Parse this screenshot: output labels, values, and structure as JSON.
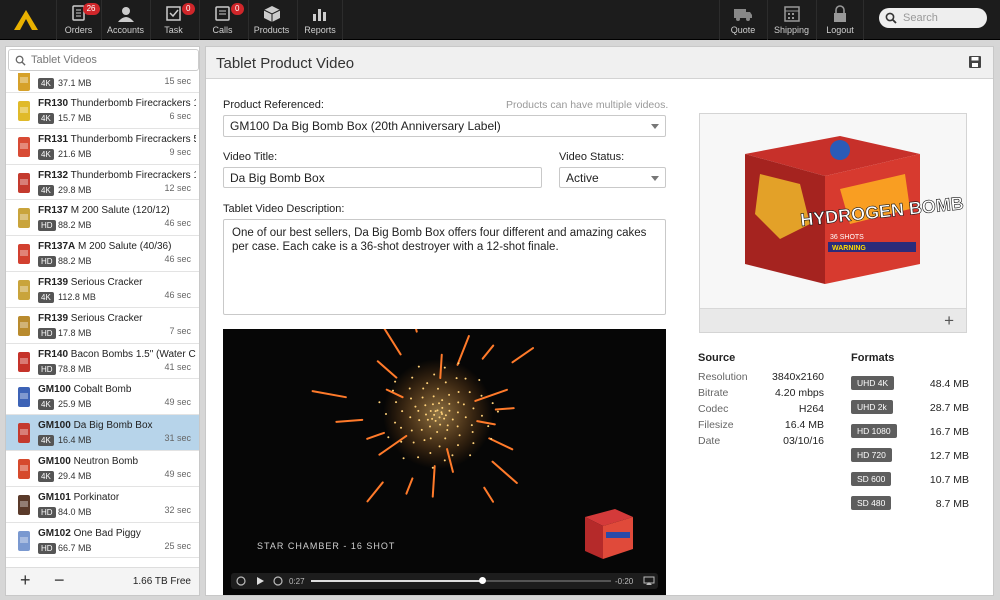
{
  "nav": {
    "items": [
      {
        "label": "Orders",
        "badge": "26"
      },
      {
        "label": "Accounts",
        "badge": ""
      },
      {
        "label": "Task",
        "badge": "0"
      },
      {
        "label": "Calls",
        "badge": "0"
      },
      {
        "label": "Products",
        "badge": ""
      },
      {
        "label": "Reports",
        "badge": ""
      }
    ],
    "right_items": [
      {
        "label": "Quote"
      },
      {
        "label": "Shipping"
      },
      {
        "label": "Logout"
      }
    ],
    "search_placeholder": "Search"
  },
  "sidebar": {
    "search_placeholder": "Tablet Videos",
    "items": [
      {
        "code": "",
        "name": "",
        "quality": "4K",
        "size": "37.1 MB",
        "duration": "15 sec",
        "selected": false
      },
      {
        "code": "FR130",
        "name": "Thunderbomb Firecrackers 1",
        "quality": "4K",
        "size": "15.7 MB",
        "duration": "6 sec",
        "selected": false
      },
      {
        "code": "FR131",
        "name": "Thunderbomb Firecrackers 5",
        "quality": "4K",
        "size": "21.6 MB",
        "duration": "9 sec",
        "selected": false
      },
      {
        "code": "FR132",
        "name": "Thunderbomb Firecrackers 1",
        "quality": "4K",
        "size": "29.8 MB",
        "duration": "12 sec",
        "selected": false
      },
      {
        "code": "FR137",
        "name": "M 200 Salute (120/12)",
        "quality": "HD",
        "size": "88.2 MB",
        "duration": "46 sec",
        "selected": false
      },
      {
        "code": "FR137A",
        "name": "M 200 Salute (40/36)",
        "quality": "HD",
        "size": "88.2 MB",
        "duration": "46 sec",
        "selected": false
      },
      {
        "code": "FR139",
        "name": "Serious Cracker",
        "quality": "4K",
        "size": "112.8 MB",
        "duration": "46 sec",
        "selected": false
      },
      {
        "code": "FR139",
        "name": "Serious Cracker",
        "quality": "HD",
        "size": "17.8 MB",
        "duration": "7 sec",
        "selected": false
      },
      {
        "code": "FR140",
        "name": "Bacon Bombs 1.5\" (Water Cr",
        "quality": "HD",
        "size": "78.8 MB",
        "duration": "41 sec",
        "selected": false
      },
      {
        "code": "GM100",
        "name": "Cobalt Bomb",
        "quality": "4K",
        "size": "25.9 MB",
        "duration": "49 sec",
        "selected": false
      },
      {
        "code": "GM100",
        "name": "Da Big Bomb Box",
        "quality": "4K",
        "size": "16.4 MB",
        "duration": "31 sec",
        "selected": true
      },
      {
        "code": "GM100",
        "name": "Neutron Bomb",
        "quality": "4K",
        "size": "29.4 MB",
        "duration": "49 sec",
        "selected": false
      },
      {
        "code": "GM101",
        "name": "Porkinator",
        "quality": "HD",
        "size": "84.0 MB",
        "duration": "32 sec",
        "selected": false
      },
      {
        "code": "GM102",
        "name": "One Bad Piggy",
        "quality": "HD",
        "size": "66.7 MB",
        "duration": "25 sec",
        "selected": false
      }
    ],
    "free_space": "1.66 TB Free"
  },
  "main": {
    "title": "Tablet Product Video",
    "product_label": "Product Referenced:",
    "product_hint": "Products can have multiple videos.",
    "product_value": "GM100 Da Big Bomb Box (20th Anniversary Label)",
    "video_title_label": "Video Title:",
    "video_title_value": "Da Big Bomb Box",
    "video_status_label": "Video Status:",
    "video_status_value": "Active",
    "description_label": "Tablet Video Description:",
    "description_value": "One of our best sellers, Da Big Bomb Box offers four different and amazing cakes per case.  Each cake is a 36-shot destroyer with a 12-shot finale.",
    "video_caption": "STAR CHAMBER - 16 SHOT",
    "video_elapsed": "0:27",
    "video_remaining": "-0:20",
    "video_progress": 0.57
  },
  "product_image": {
    "brand_text": "HYDROGEN BOMB",
    "subtext": "36 SHOTS",
    "warning": "WARNING"
  },
  "source": {
    "title": "Source",
    "rows": [
      {
        "key": "Resolution",
        "value": "3840x2160"
      },
      {
        "key": "Bitrate",
        "value": "4.20 mbps"
      },
      {
        "key": "Codec",
        "value": "H264"
      },
      {
        "key": "Filesize",
        "value": "16.4 MB"
      },
      {
        "key": "Date",
        "value": "03/10/16"
      }
    ]
  },
  "formats": {
    "title": "Formats",
    "rows": [
      {
        "label": "UHD 4K",
        "size": "48.4 MB"
      },
      {
        "label": "UHD 2k",
        "size": "28.7 MB"
      },
      {
        "label": "HD 1080",
        "size": "16.7 MB"
      },
      {
        "label": "HD 720",
        "size": "12.7 MB"
      },
      {
        "label": "SD 600",
        "size": "10.7 MB"
      },
      {
        "label": "SD 480",
        "size": "8.7 MB"
      }
    ]
  },
  "colors": {
    "topbar": "#1c1c1c",
    "badge": "#d0262a",
    "selected_row": "#b7d4ea"
  }
}
